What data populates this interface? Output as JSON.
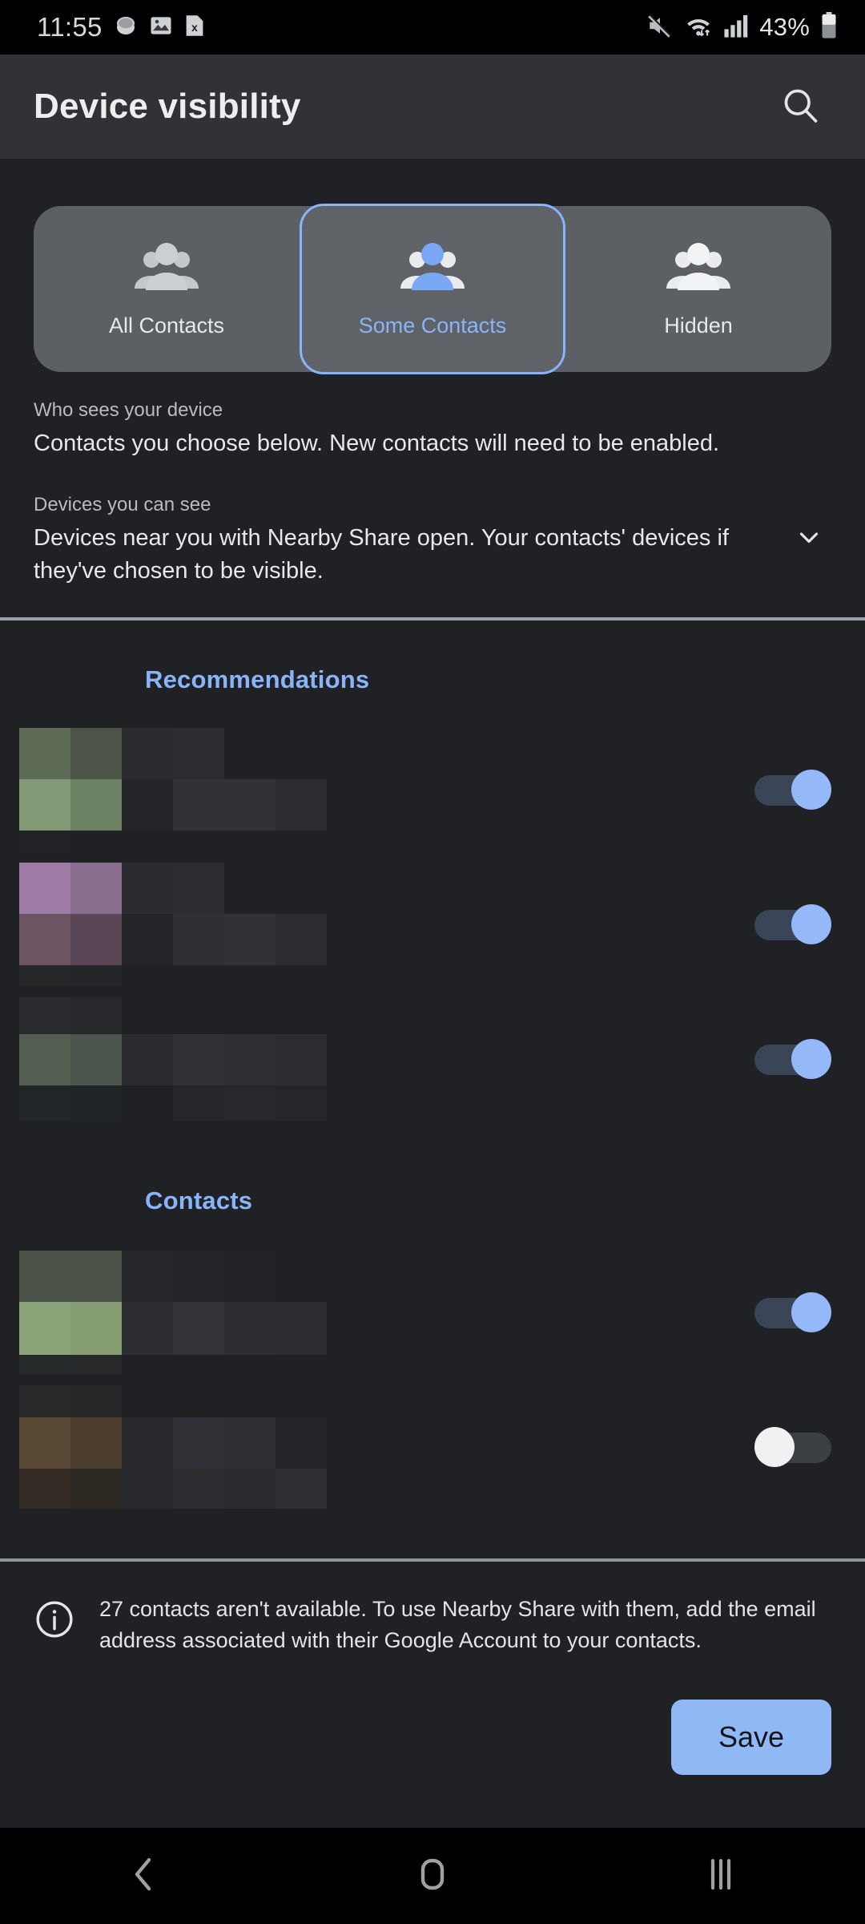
{
  "statusbar": {
    "time": "11:55",
    "battery_percent": "43%",
    "icons": [
      "capsule-icon",
      "image-icon",
      "sim-card-x-icon",
      "mute-icon",
      "wifi-icon",
      "signal-bars-icon",
      "battery-icon"
    ]
  },
  "appbar": {
    "title": "Device visibility",
    "search_icon": "search-icon"
  },
  "visibility": {
    "options": [
      {
        "label": "All Contacts",
        "icon": "group-people-icon",
        "selected": false
      },
      {
        "label": "Some Contacts",
        "icon": "group-people-icon",
        "selected": true
      },
      {
        "label": "Hidden",
        "icon": "group-people-icon",
        "selected": false
      }
    ]
  },
  "descriptions": [
    {
      "label": "Who sees your device",
      "text": "Contacts you choose below. New contacts will need to be enabled."
    },
    {
      "label": "Devices you can see",
      "text": "Devices near you with Nearby Share open. Your contacts' devices if they've chosen to be visible."
    }
  ],
  "expander_icon": "chevron-down-icon",
  "sections": [
    {
      "title": "Recommendations",
      "rows": [
        {
          "name": "",
          "avatar_color": "#7d9271",
          "toggle": "on"
        },
        {
          "name": "",
          "avatar_color": "#9a7d9e",
          "toggle": "on"
        },
        {
          "name": "",
          "avatar_color": "#576058",
          "toggle": "on"
        }
      ]
    },
    {
      "title": "Contacts",
      "rows": [
        {
          "name": "",
          "avatar_color": "#8ba378",
          "toggle": "on"
        },
        {
          "name": "",
          "avatar_color": "#5c4a38",
          "toggle": "off"
        }
      ]
    }
  ],
  "footer": {
    "info_icon": "info-icon",
    "text": "27 contacts aren't available. To use Nearby Share with them, add the email address associated with their Google Account to your contacts.",
    "save_label": "Save"
  },
  "navbar": {
    "back": "back-icon",
    "home": "home-icon",
    "recents": "recents-icon"
  },
  "colors": {
    "accent": "#8ab4f8",
    "save_bg": "#8fb8f5",
    "appbar_bg": "#303236",
    "page_bg": "#1f2124",
    "seg_bg": "#5c5f64"
  }
}
